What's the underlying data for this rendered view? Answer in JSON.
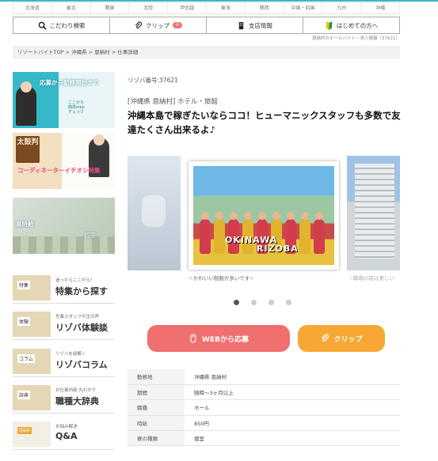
{
  "regions": [
    "北海道",
    "東北",
    "関東",
    "北陸",
    "甲信越",
    "東海",
    "関西",
    "中国・四国",
    "九州",
    "沖縄"
  ],
  "toolbar": {
    "search_label": "こだわり検索",
    "clip_label": "クリップ",
    "clip_count": "0",
    "office_label": "支店情報",
    "beginner_label": "はじめての方へ"
  },
  "site_note": "恩納村のホールバイト・求人情報（37621）",
  "breadcrumb": "リゾートバイトTOP > 沖縄県 > 恩納村 > 仕事詳細",
  "banners": {
    "b1_text": "応募から勤務開始まで",
    "b1_small": "ここから簡単stepチェック",
    "b2_kanji": "太鼓判",
    "b2_text": "コーディネーターイチオシ特集",
    "b3_text": "高時給",
    "b3_text2": "個室"
  },
  "menu": [
    {
      "sub": "迷ったらここから！",
      "main": "特集から探す",
      "tag": "特集"
    },
    {
      "sub": "先輩スタッフの生の声",
      "main": "リゾバ体験談",
      "tag": "体験"
    },
    {
      "sub": "リゾバを紐解く",
      "main": "リゾバコラム",
      "tag": "コラム"
    },
    {
      "sub": "お仕事内容 丸わかり",
      "main": "職種大辞典",
      "tag": "辞典"
    },
    {
      "sub": "お悩み解決",
      "main": "Q&A",
      "tag": "Q&A"
    }
  ],
  "job": {
    "number": "リゾバ番号:37621",
    "area": "[沖縄県 恩納村] ホテル・旅館",
    "title": "沖縄本島で稼ぎたいならココ！ヒューマニックスタッフも多数で友達たくさん出来るよ♪"
  },
  "slider": {
    "logo_line1": "OKINAWA",
    "logo_line2": "RIZOBA",
    "caption": "☆かわいい制服が多いです☆",
    "caption_next": "☆職場の前は美しい",
    "active_index": 0,
    "count": 4
  },
  "buttons": {
    "apply": "WEBから応募",
    "clip": "クリップ"
  },
  "info": [
    {
      "k": "勤務地",
      "v": "沖縄県 恩納村"
    },
    {
      "k": "期間",
      "v": "随時～3ヶ月以上"
    },
    {
      "k": "職種",
      "v": "ホール"
    },
    {
      "k": "時給",
      "v": "850円"
    },
    {
      "k": "寮の種類",
      "v": "個室"
    }
  ],
  "colors": {
    "accent": "#3cb6c8",
    "apply": "#f06f6f",
    "clip": "#f7a733"
  }
}
